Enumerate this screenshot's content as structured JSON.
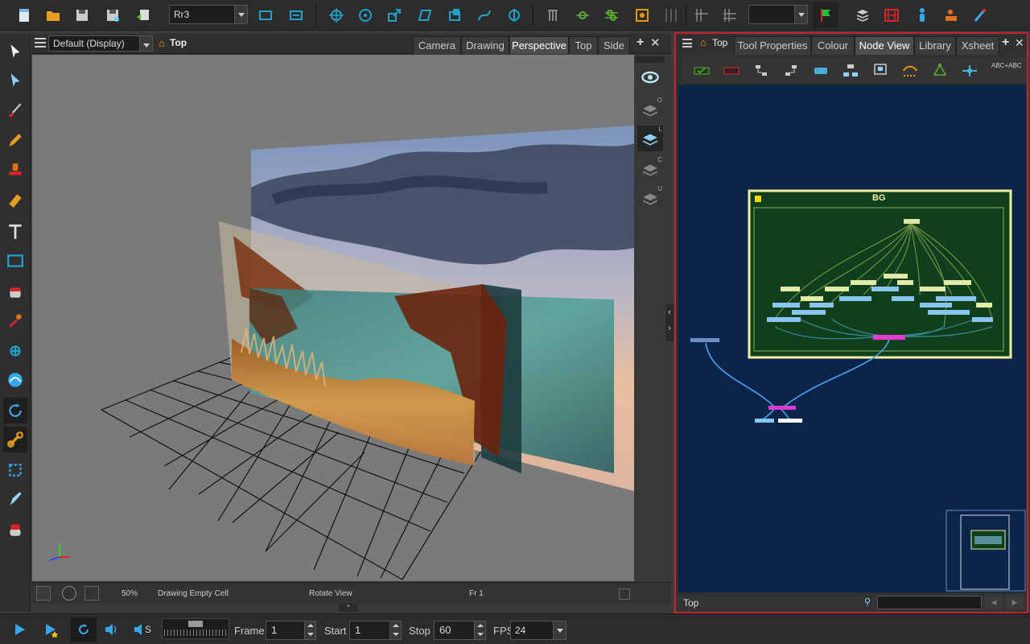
{
  "toolbar": {
    "drawing_name": "Rr3",
    "colors": {
      "accent_teal": "#1fa3c9",
      "accent_green": "#5fae34",
      "accent_orange": "#e29a18",
      "alert_red": "#d8232a"
    }
  },
  "viewport": {
    "display_select": "Default (Display)",
    "top_label": "Top",
    "tabs": [
      "Camera",
      "Drawing",
      "Perspective",
      "Top",
      "Side"
    ],
    "active_tab": "Perspective",
    "side_badges": [
      "O",
      "L",
      "C",
      "U"
    ],
    "status": {
      "zoom": "50%",
      "message": "Drawing Empty Cell",
      "tool": "Rotate View",
      "frame": "Fr 1"
    }
  },
  "right_panel": {
    "top_label": "Top",
    "tabs": [
      "Tool Properties",
      "Colour",
      "Node View",
      "Library",
      "Xsheet"
    ],
    "active_tab": "Node View",
    "toolbar_text": "ABC+ABC",
    "group_label": "BG",
    "status_label": "Top",
    "search_placeholder": ""
  },
  "playback": {
    "frame_label": "Frame",
    "frame_value": "1",
    "start_label": "Start",
    "start_value": "1",
    "stop_label": "Stop",
    "stop_value": "60",
    "fps_label": "FPS",
    "fps_value": "24",
    "sound_scrub_label": "S"
  }
}
